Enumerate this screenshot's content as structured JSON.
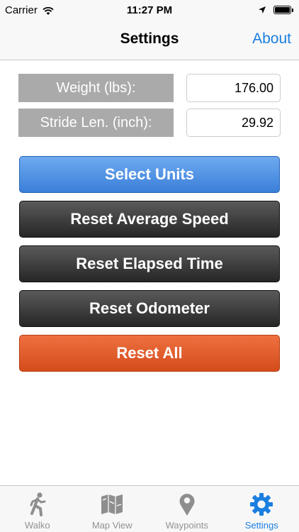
{
  "status_bar": {
    "carrier": "Carrier",
    "time": "11:27 PM",
    "battery_level": 1.0
  },
  "nav": {
    "title": "Settings",
    "about_label": "About"
  },
  "fields": {
    "weight_label": "Weight (lbs):",
    "weight_value": "176.00",
    "stride_label": "Stride Len. (inch):",
    "stride_value": "29.92"
  },
  "buttons": {
    "select_units": "Select Units",
    "reset_average_speed": "Reset Average Speed",
    "reset_elapsed_time": "Reset Elapsed Time",
    "reset_odometer": "Reset Odometer",
    "reset_all": "Reset All"
  },
  "tabs": [
    {
      "label": "Walko",
      "icon": "walking-person-icon"
    },
    {
      "label": "Map View",
      "icon": "map-icon"
    },
    {
      "label": "Waypoints",
      "icon": "map-pin-icon"
    },
    {
      "label": "Settings",
      "icon": "gear-icon",
      "active": true
    }
  ],
  "colors": {
    "accent": "#1b7fe0",
    "select_units_button": "#4a8ee6",
    "dark_button": "#3a3a3a",
    "reset_all_button": "#e05a2a",
    "label_background": "#aaaaaa"
  }
}
